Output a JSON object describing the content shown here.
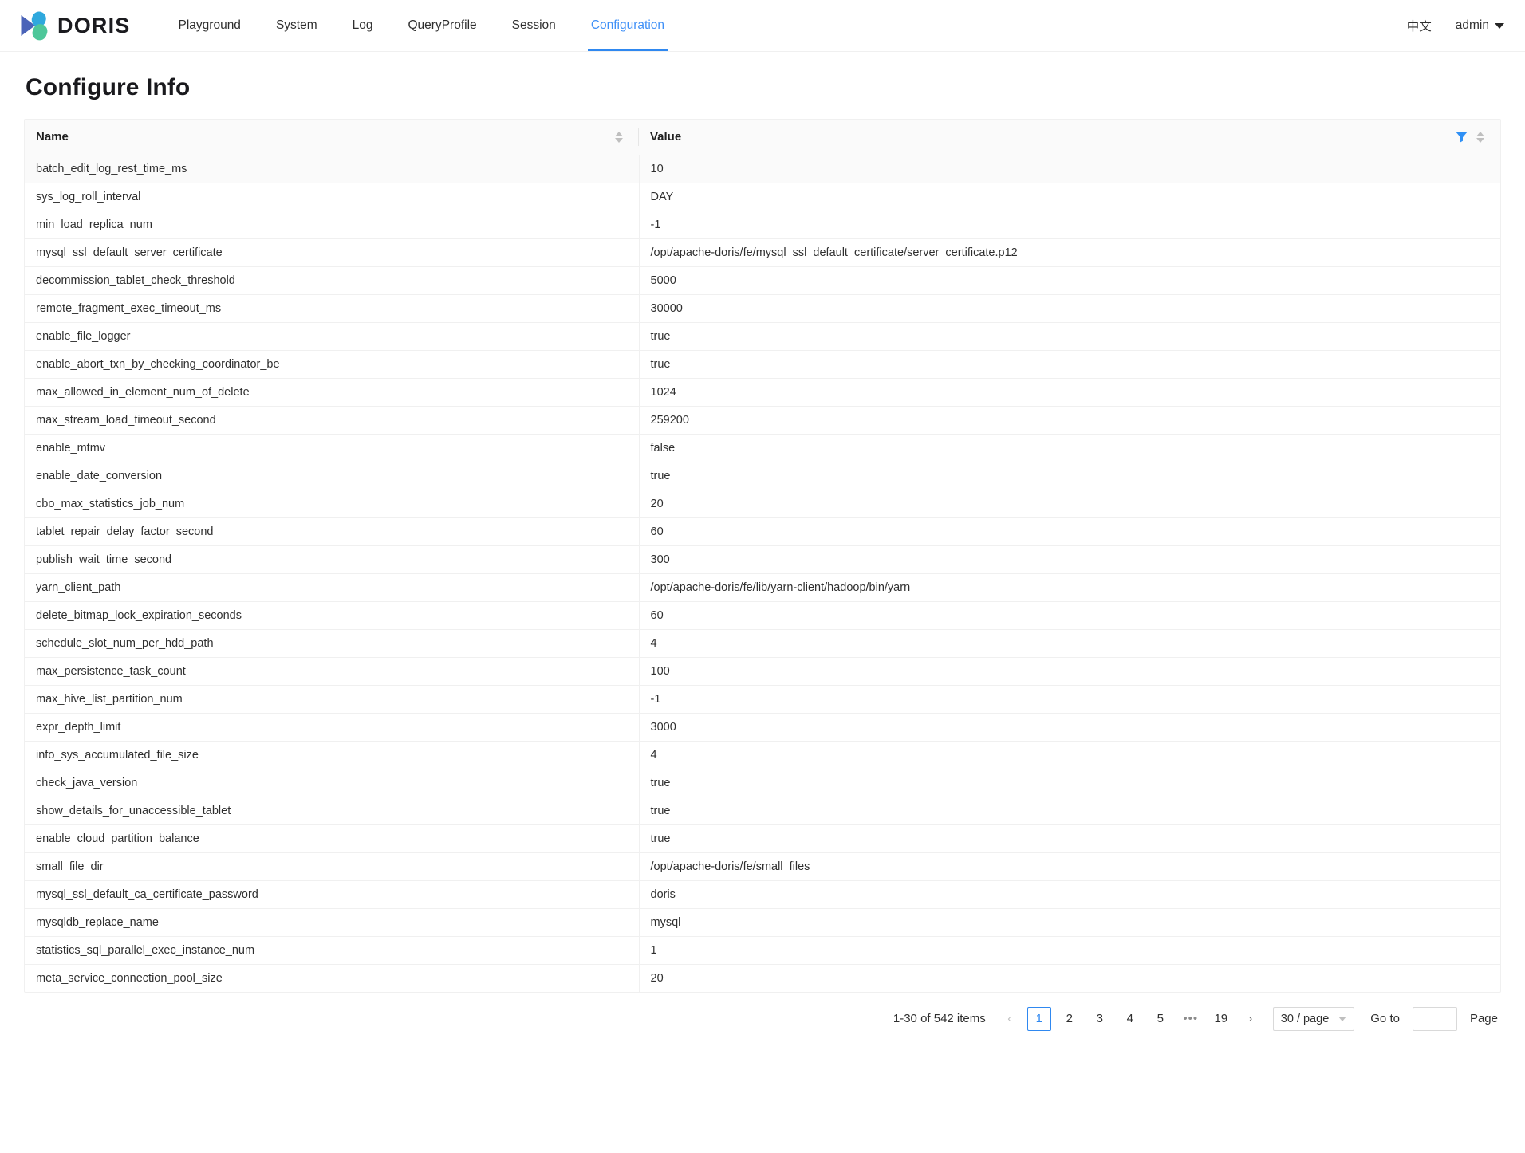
{
  "header": {
    "brand": "DORIS",
    "logo_icon": "doris-logo-icon",
    "nav": [
      {
        "label": "Playground",
        "active": false
      },
      {
        "label": "System",
        "active": false
      },
      {
        "label": "Log",
        "active": false
      },
      {
        "label": "QueryProfile",
        "active": false
      },
      {
        "label": "Session",
        "active": false
      },
      {
        "label": "Configuration",
        "active": true
      }
    ],
    "lang": "中文",
    "user": "admin",
    "user_caret_icon": "caret-down-icon",
    "accent_color": "#2f88f0"
  },
  "page": {
    "title": "Configure Info"
  },
  "table": {
    "columns": [
      {
        "key": "name",
        "label": "Name",
        "sortable": true
      },
      {
        "key": "value",
        "label": "Value",
        "sortable": true
      }
    ],
    "filter_icon": "filter-funnel-icon",
    "sort_icon": "sort-updown-icon",
    "filter_icon_color": "#2f90f5",
    "rows": [
      {
        "name": "batch_edit_log_rest_time_ms",
        "value": "10"
      },
      {
        "name": "sys_log_roll_interval",
        "value": "DAY"
      },
      {
        "name": "min_load_replica_num",
        "value": "-1"
      },
      {
        "name": "mysql_ssl_default_server_certificate",
        "value": "/opt/apache-doris/fe/mysql_ssl_default_certificate/server_certificate.p12"
      },
      {
        "name": "decommission_tablet_check_threshold",
        "value": "5000"
      },
      {
        "name": "remote_fragment_exec_timeout_ms",
        "value": "30000"
      },
      {
        "name": "enable_file_logger",
        "value": "true"
      },
      {
        "name": "enable_abort_txn_by_checking_coordinator_be",
        "value": "true"
      },
      {
        "name": "max_allowed_in_element_num_of_delete",
        "value": "1024"
      },
      {
        "name": "max_stream_load_timeout_second",
        "value": "259200"
      },
      {
        "name": "enable_mtmv",
        "value": "false"
      },
      {
        "name": "enable_date_conversion",
        "value": "true"
      },
      {
        "name": "cbo_max_statistics_job_num",
        "value": "20"
      },
      {
        "name": "tablet_repair_delay_factor_second",
        "value": "60"
      },
      {
        "name": "publish_wait_time_second",
        "value": "300"
      },
      {
        "name": "yarn_client_path",
        "value": "/opt/apache-doris/fe/lib/yarn-client/hadoop/bin/yarn"
      },
      {
        "name": "delete_bitmap_lock_expiration_seconds",
        "value": "60"
      },
      {
        "name": "schedule_slot_num_per_hdd_path",
        "value": "4"
      },
      {
        "name": "max_persistence_task_count",
        "value": "100"
      },
      {
        "name": "max_hive_list_partition_num",
        "value": "-1"
      },
      {
        "name": "expr_depth_limit",
        "value": "3000"
      },
      {
        "name": "info_sys_accumulated_file_size",
        "value": "4"
      },
      {
        "name": "check_java_version",
        "value": "true"
      },
      {
        "name": "show_details_for_unaccessible_tablet",
        "value": "true"
      },
      {
        "name": "enable_cloud_partition_balance",
        "value": "true"
      },
      {
        "name": "small_file_dir",
        "value": "/opt/apache-doris/fe/small_files"
      },
      {
        "name": "mysql_ssl_default_ca_certificate_password",
        "value": "doris"
      },
      {
        "name": "mysqldb_replace_name",
        "value": "mysql"
      },
      {
        "name": "statistics_sql_parallel_exec_instance_num",
        "value": "1"
      },
      {
        "name": "meta_service_connection_pool_size",
        "value": "20"
      }
    ]
  },
  "pagination": {
    "total_text": "1-30 of 542 items",
    "prev_symbol": "‹",
    "next_symbol": "›",
    "pages": [
      "1",
      "2",
      "3",
      "4",
      "5"
    ],
    "ellipsis": "•••",
    "last_page": "19",
    "current_page": "1",
    "page_size_label": "30 / page",
    "goto_label": "Go to",
    "goto_value": "",
    "page_label": "Page"
  }
}
